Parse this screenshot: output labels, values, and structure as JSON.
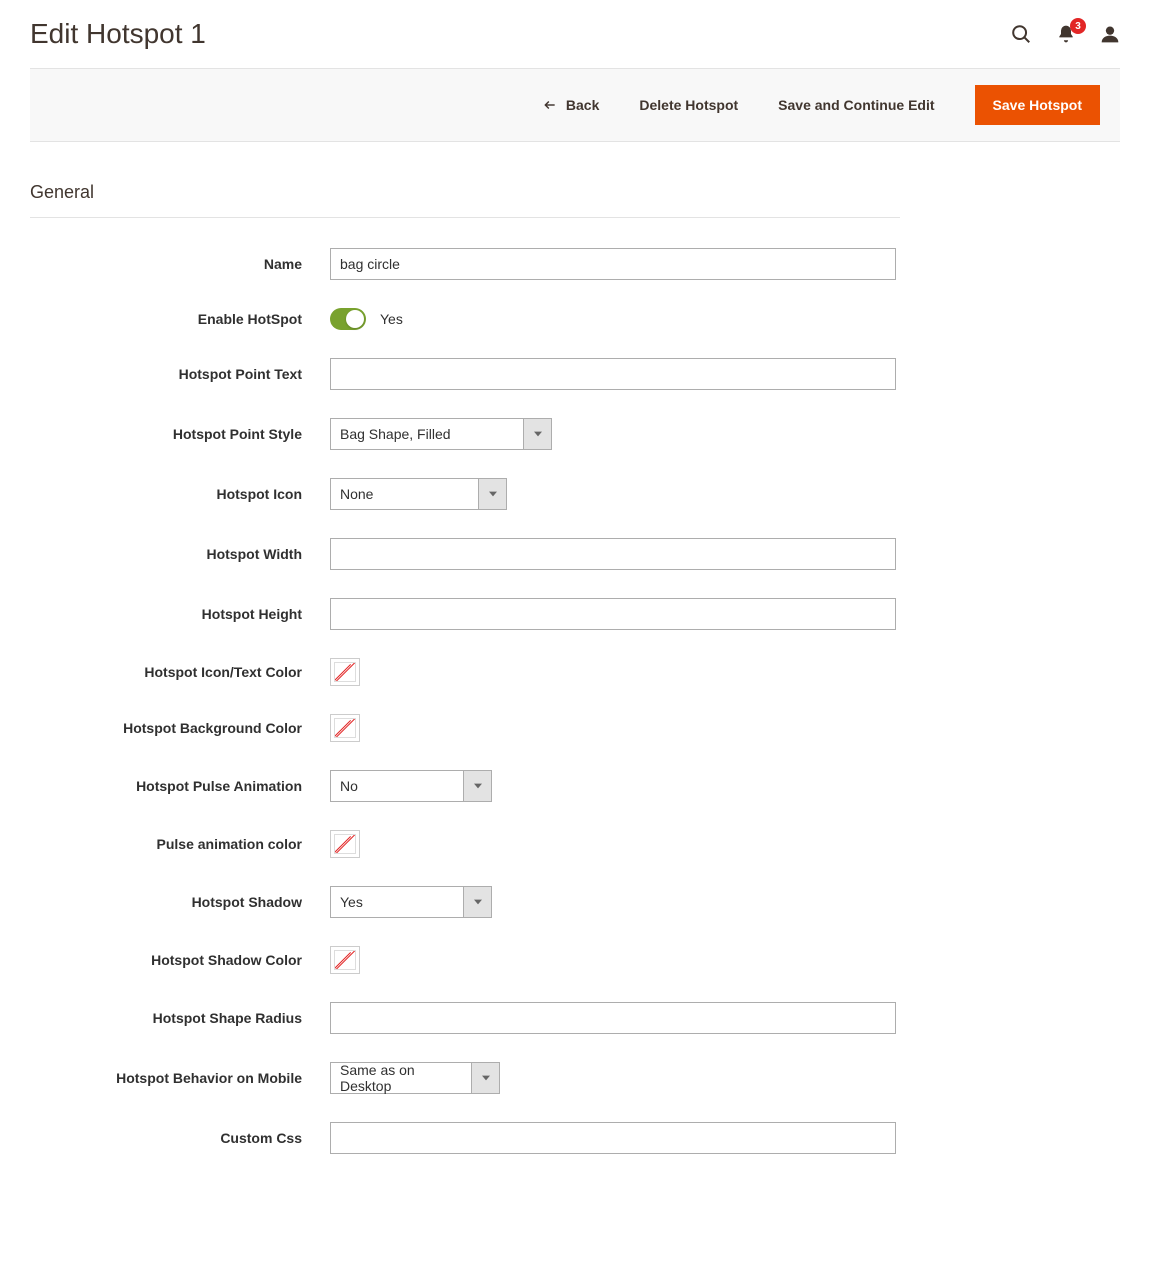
{
  "header": {
    "title": "Edit Hotspot 1",
    "notifications_count": "3"
  },
  "actions": {
    "back": "Back",
    "delete": "Delete Hotspot",
    "save_continue": "Save and Continue Edit",
    "save": "Save Hotspot"
  },
  "section": {
    "title": "General"
  },
  "fields": {
    "name": {
      "label": "Name",
      "value": "bag circle"
    },
    "enable": {
      "label": "Enable HotSpot",
      "value": "Yes"
    },
    "point_text": {
      "label": "Hotspot Point Text",
      "value": ""
    },
    "point_style": {
      "label": "Hotspot Point Style",
      "value": "Bag Shape, Filled"
    },
    "icon": {
      "label": "Hotspot Icon",
      "value": "None"
    },
    "width": {
      "label": "Hotspot Width",
      "value": ""
    },
    "height": {
      "label": "Hotspot Height",
      "value": ""
    },
    "icon_text_color": {
      "label": "Hotspot Icon/Text Color"
    },
    "bg_color": {
      "label": "Hotspot Background Color"
    },
    "pulse": {
      "label": "Hotspot Pulse Animation",
      "value": "No"
    },
    "pulse_color": {
      "label": "Pulse animation color"
    },
    "shadow": {
      "label": "Hotspot Shadow",
      "value": "Yes"
    },
    "shadow_color": {
      "label": "Hotspot Shadow Color"
    },
    "shape_radius": {
      "label": "Hotspot Shape Radius",
      "value": ""
    },
    "mobile": {
      "label": "Hotspot Behavior on Mobile",
      "value": "Same as on Desktop"
    },
    "custom_css": {
      "label": "Custom Css",
      "value": ""
    }
  }
}
